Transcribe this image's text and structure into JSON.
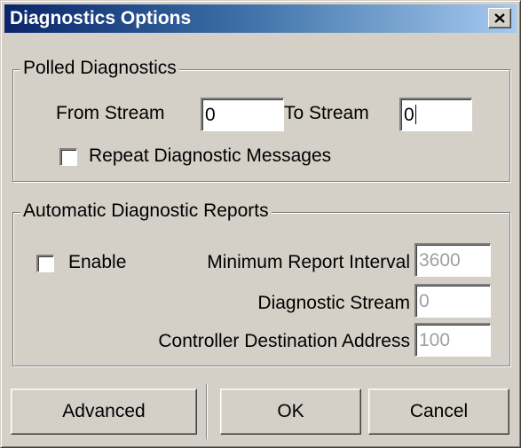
{
  "dialog": {
    "title": "Diagnostics Options"
  },
  "polled": {
    "legend": "Polled Diagnostics",
    "from_stream_label": "From Stream",
    "from_stream_value": "0",
    "to_stream_label": "To Stream",
    "to_stream_value": "0",
    "repeat_label": "Repeat Diagnostic Messages",
    "repeat_checked": false
  },
  "automatic": {
    "legend": "Automatic Diagnostic Reports",
    "enable_label": "Enable",
    "enable_checked": false,
    "min_interval_label": "Minimum Report Interval",
    "min_interval_value": "3600",
    "diag_stream_label": "Diagnostic Stream",
    "diag_stream_value": "0",
    "controller_addr_label": "Controller Destination Address",
    "controller_addr_value": "100"
  },
  "buttons": {
    "advanced": "Advanced",
    "ok": "OK",
    "cancel": "Cancel"
  },
  "icons": {
    "close": "close-icon"
  }
}
